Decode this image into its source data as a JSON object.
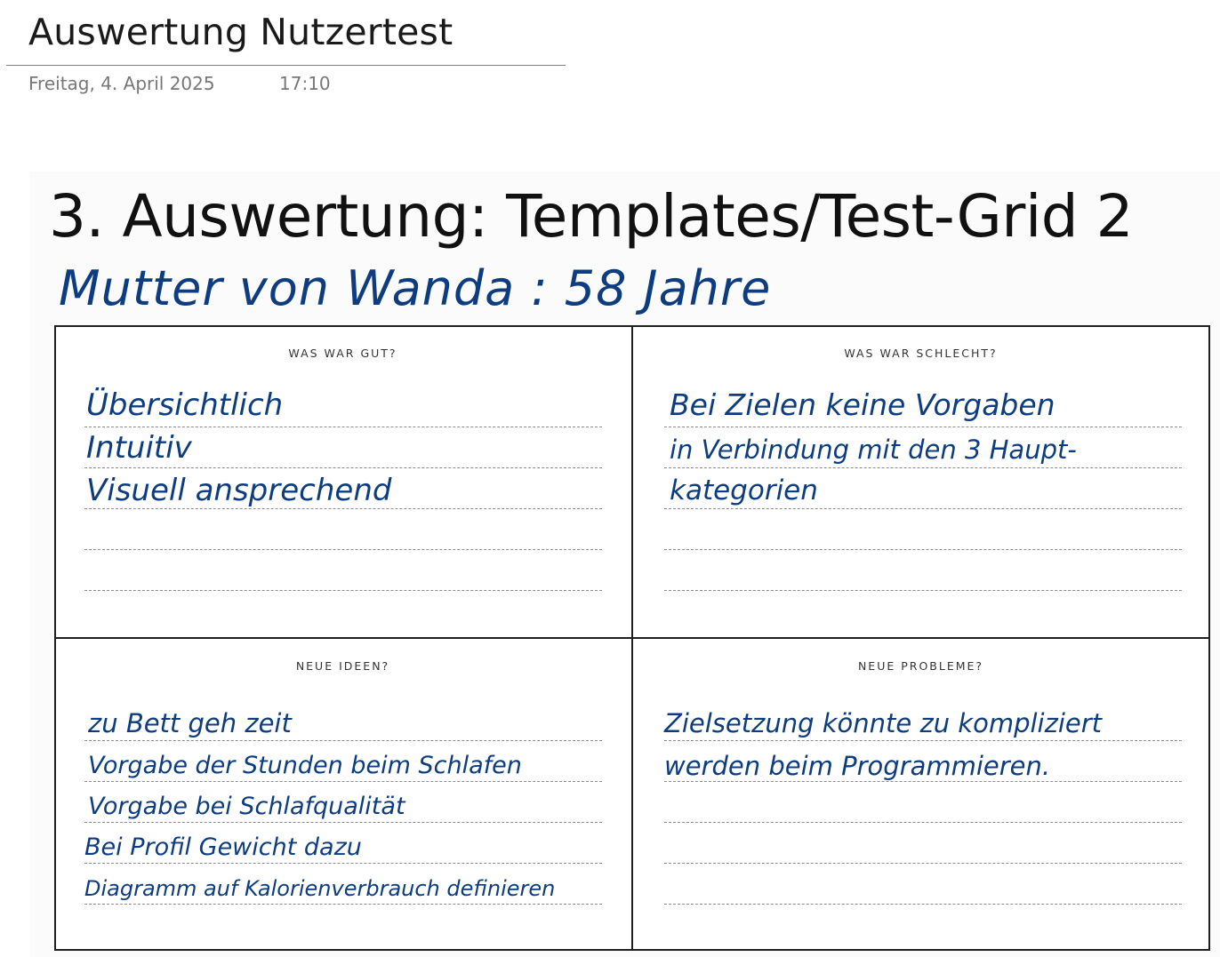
{
  "page": {
    "title": "Auswertung Nutzertest",
    "date": "Freitag, 4. April 2025",
    "time": "17:10"
  },
  "content": {
    "heading": "3. Auswertung: Templates/Test-Grid 2",
    "participant_note": "Mutter von Wanda : 58 Jahre",
    "ink_color": "#0d3d80",
    "quadrants": {
      "good": {
        "label": "WAS WAR GUT?",
        "entries": [
          "Übersichtlich",
          "Intuitiv",
          "Visuell ansprechend"
        ]
      },
      "bad": {
        "label": "WAS WAR SCHLECHT?",
        "entries": [
          "Bei Zielen keine Vorgaben",
          "in Verbindung mit den 3 Haupt-",
          "kategorien"
        ]
      },
      "ideas": {
        "label": "NEUE IDEEN?",
        "entries": [
          "zu Bett geh zeit",
          "Vorgabe der Stunden beim Schlafen",
          "Vorgabe bei Schlafqualität",
          "Bei Profil Gewicht dazu",
          "Diagramm auf Kalorienverbrauch definieren"
        ]
      },
      "problems": {
        "label": "NEUE PROBLEME?",
        "entries": [
          "Zielsetzung könnte zu kompliziert",
          "werden beim Programmieren."
        ]
      }
    }
  }
}
